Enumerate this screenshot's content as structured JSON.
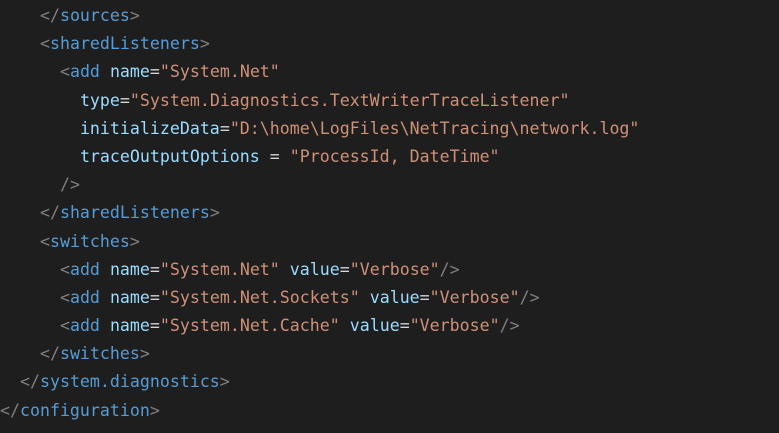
{
  "editor": {
    "theme": "dark",
    "colors": {
      "background": "#1e1e1e",
      "punctuation": "#808080",
      "tag": "#569cd6",
      "attribute": "#9cdcfe",
      "string": "#ce9178",
      "text": "#d4d4d4"
    },
    "lines": [
      {
        "indent": "    ",
        "tokens": [
          {
            "t": "pun",
            "v": "</"
          },
          {
            "t": "tag",
            "v": "sources"
          },
          {
            "t": "pun",
            "v": ">"
          }
        ]
      },
      {
        "indent": "    ",
        "tokens": [
          {
            "t": "pun",
            "v": "<"
          },
          {
            "t": "tag",
            "v": "sharedListeners"
          },
          {
            "t": "pun",
            "v": ">"
          }
        ]
      },
      {
        "indent": "      ",
        "tokens": [
          {
            "t": "pun",
            "v": "<"
          },
          {
            "t": "tag",
            "v": "add"
          },
          {
            "t": "ws",
            "v": " "
          },
          {
            "t": "attr",
            "v": "name"
          },
          {
            "t": "eq",
            "v": "="
          },
          {
            "t": "str",
            "v": "\"System.Net\""
          }
        ]
      },
      {
        "indent": "        ",
        "tokens": [
          {
            "t": "attr",
            "v": "type"
          },
          {
            "t": "eq",
            "v": "="
          },
          {
            "t": "str",
            "v": "\"System.Diagnostics.TextWriterTraceListener\""
          }
        ]
      },
      {
        "indent": "        ",
        "tokens": [
          {
            "t": "attr",
            "v": "initializeData"
          },
          {
            "t": "eq",
            "v": "="
          },
          {
            "t": "str",
            "v": "\"D:\\home\\LogFiles\\NetTracing\\network.log\""
          }
        ]
      },
      {
        "indent": "        ",
        "tokens": [
          {
            "t": "attr",
            "v": "traceOutputOptions"
          },
          {
            "t": "eq",
            "v": " = "
          },
          {
            "t": "str",
            "v": "\"ProcessId, DateTime\""
          }
        ]
      },
      {
        "indent": "      ",
        "tokens": [
          {
            "t": "pun",
            "v": "/>"
          }
        ]
      },
      {
        "indent": "    ",
        "tokens": [
          {
            "t": "pun",
            "v": "</"
          },
          {
            "t": "tag",
            "v": "sharedListeners"
          },
          {
            "t": "pun",
            "v": ">"
          }
        ]
      },
      {
        "indent": "    ",
        "tokens": [
          {
            "t": "pun",
            "v": "<"
          },
          {
            "t": "tag",
            "v": "switches"
          },
          {
            "t": "pun",
            "v": ">"
          }
        ]
      },
      {
        "indent": "      ",
        "tokens": [
          {
            "t": "pun",
            "v": "<"
          },
          {
            "t": "tag",
            "v": "add"
          },
          {
            "t": "ws",
            "v": " "
          },
          {
            "t": "attr",
            "v": "name"
          },
          {
            "t": "eq",
            "v": "="
          },
          {
            "t": "str",
            "v": "\"System.Net\""
          },
          {
            "t": "ws",
            "v": " "
          },
          {
            "t": "attr",
            "v": "value"
          },
          {
            "t": "eq",
            "v": "="
          },
          {
            "t": "str",
            "v": "\"Verbose\""
          },
          {
            "t": "pun",
            "v": "/>"
          }
        ]
      },
      {
        "indent": "      ",
        "tokens": [
          {
            "t": "pun",
            "v": "<"
          },
          {
            "t": "tag",
            "v": "add"
          },
          {
            "t": "ws",
            "v": " "
          },
          {
            "t": "attr",
            "v": "name"
          },
          {
            "t": "eq",
            "v": "="
          },
          {
            "t": "str",
            "v": "\"System.Net.Sockets\""
          },
          {
            "t": "ws",
            "v": " "
          },
          {
            "t": "attr",
            "v": "value"
          },
          {
            "t": "eq",
            "v": "="
          },
          {
            "t": "str",
            "v": "\"Verbose\""
          },
          {
            "t": "pun",
            "v": "/>"
          }
        ]
      },
      {
        "indent": "      ",
        "tokens": [
          {
            "t": "pun",
            "v": "<"
          },
          {
            "t": "tag",
            "v": "add"
          },
          {
            "t": "ws",
            "v": " "
          },
          {
            "t": "attr",
            "v": "name"
          },
          {
            "t": "eq",
            "v": "="
          },
          {
            "t": "str",
            "v": "\"System.Net.Cache\""
          },
          {
            "t": "ws",
            "v": " "
          },
          {
            "t": "attr",
            "v": "value"
          },
          {
            "t": "eq",
            "v": "="
          },
          {
            "t": "str",
            "v": "\"Verbose\""
          },
          {
            "t": "pun",
            "v": "/>"
          }
        ]
      },
      {
        "indent": "    ",
        "tokens": [
          {
            "t": "pun",
            "v": "</"
          },
          {
            "t": "tag",
            "v": "switches"
          },
          {
            "t": "pun",
            "v": ">"
          }
        ]
      },
      {
        "indent": "  ",
        "tokens": [
          {
            "t": "pun",
            "v": "</"
          },
          {
            "t": "tag",
            "v": "system.diagnostics"
          },
          {
            "t": "pun",
            "v": ">"
          }
        ]
      },
      {
        "indent": "",
        "tokens": [
          {
            "t": "pun",
            "v": "</"
          },
          {
            "t": "tag",
            "v": "configuration"
          },
          {
            "t": "pun",
            "v": ">"
          }
        ]
      }
    ]
  }
}
